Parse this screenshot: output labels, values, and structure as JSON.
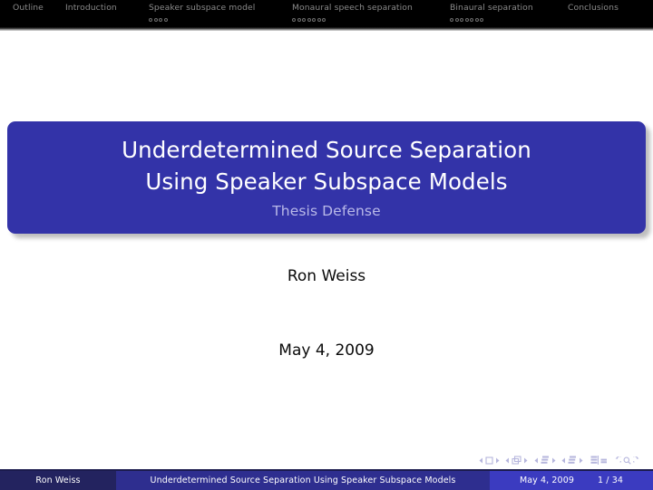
{
  "header": {
    "sections": [
      {
        "label": "Outline",
        "slides": 0
      },
      {
        "label": "Introduction",
        "slides": 0
      },
      {
        "label": "Speaker subspace model",
        "slides": 4
      },
      {
        "label": "Monaural speech separation",
        "slides": 7
      },
      {
        "label": "Binaural separation",
        "slides": 7
      },
      {
        "label": "Conclusions",
        "slides": 0
      }
    ]
  },
  "title_block": {
    "title_line1": "Underdetermined Source Separation",
    "title_line2": "Using Speaker Subspace Models",
    "subtitle": "Thesis Defense",
    "background_color": "#3333a8",
    "title_color": "#ffffff",
    "subtitle_color": "#b9b9e8"
  },
  "author": "Ron Weiss",
  "date": "May 4, 2009",
  "nav_symbols": [
    {
      "name": "slide-previous",
      "glyph": "triangle-left"
    },
    {
      "name": "slide-current",
      "glyph": "square"
    },
    {
      "name": "slide-next",
      "glyph": "triangle-right"
    },
    {
      "name": "frame-previous",
      "glyph": "triangle-left"
    },
    {
      "name": "frame-current",
      "glyph": "stacked-squares"
    },
    {
      "name": "frame-next",
      "glyph": "triangle-right"
    },
    {
      "name": "subsection-previous",
      "glyph": "triangle-left"
    },
    {
      "name": "subsection-current",
      "glyph": "stacked-lines"
    },
    {
      "name": "subsection-next",
      "glyph": "triangle-right"
    },
    {
      "name": "section-previous",
      "glyph": "triangle-left"
    },
    {
      "name": "section-current",
      "glyph": "stacked-lines"
    },
    {
      "name": "section-next",
      "glyph": "triangle-right"
    },
    {
      "name": "presentation",
      "glyph": "doc-left"
    },
    {
      "name": "appendix",
      "glyph": "doc-right"
    },
    {
      "name": "back",
      "glyph": "arrow-back"
    },
    {
      "name": "search",
      "glyph": "magnifier"
    },
    {
      "name": "forward",
      "glyph": "arrow-forward"
    }
  ],
  "footer": {
    "author": "Ron Weiss",
    "title": "Underdetermined Source Separation Using Speaker Subspace Models",
    "date": "May 4, 2009",
    "page_current": "1",
    "page_separator": "/",
    "page_total": "34",
    "segment_colors": [
      "#23235f",
      "#2e2e8f",
      "#3b3bc0"
    ]
  }
}
